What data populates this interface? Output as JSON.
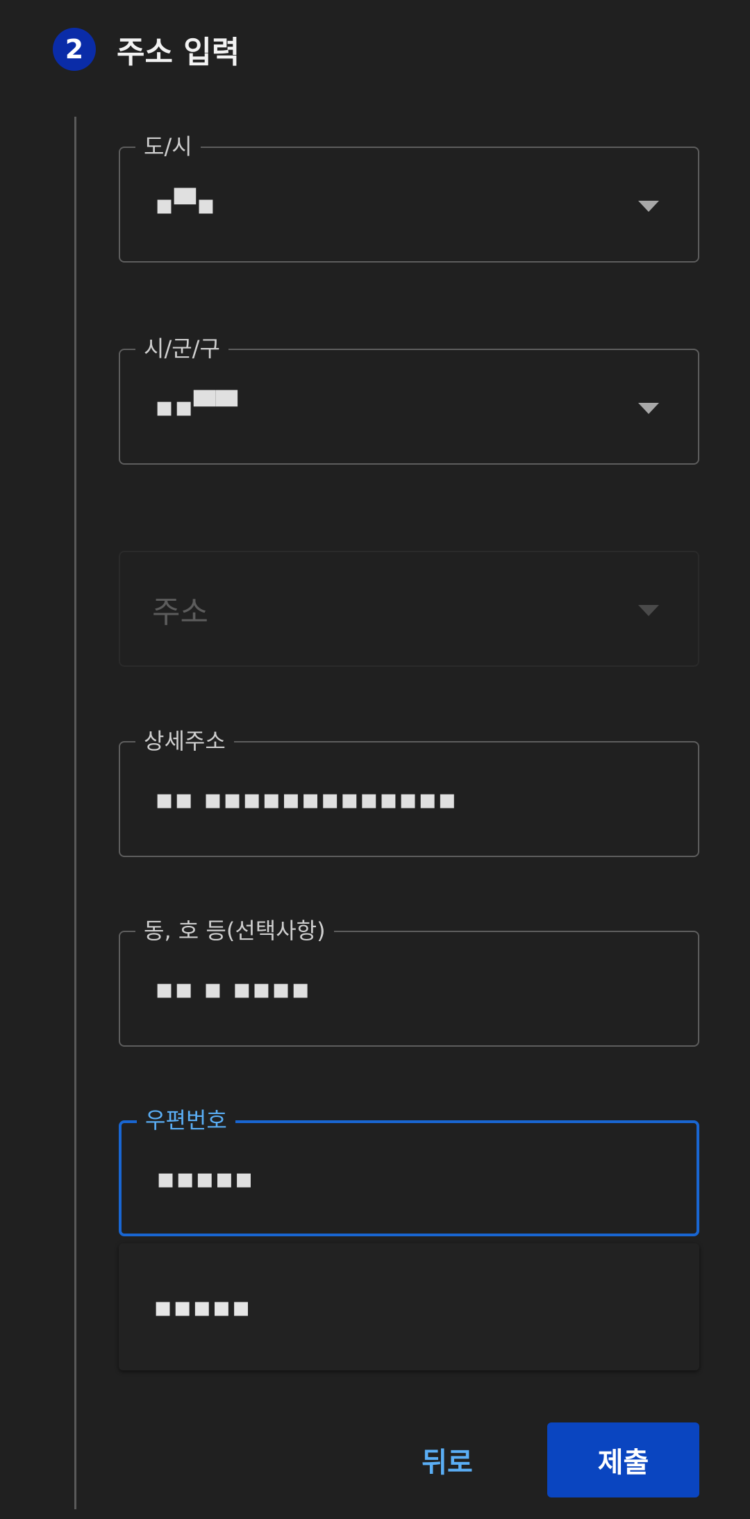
{
  "step": {
    "number": "2",
    "title": "주소 입력"
  },
  "fields": {
    "province": {
      "label": "도/시",
      "value": "▪▀▪"
    },
    "city": {
      "label": "시/군/구",
      "value": "▪▪▀▀"
    },
    "address": {
      "placeholder": "주소"
    },
    "detail": {
      "label": "상세주소",
      "value": "▪▪ ▪▪▪▪▪▪▪▪▪▪▪▪▪"
    },
    "unit": {
      "label": "동, 호 등(선택사항)",
      "value": "▪▪ ▪ ▪▪▪▪"
    },
    "postal": {
      "label": "우편번호",
      "value": "▪▪▪▪▪"
    }
  },
  "suggestion": {
    "value": "▪▪▪▪▪"
  },
  "buttons": {
    "back": "뒤로",
    "submit": "제출"
  },
  "colors": {
    "accent": "#1966d2",
    "step_circle": "#0a2ca8",
    "submit_bg": "#0a45c0",
    "link": "#5aaef5"
  }
}
